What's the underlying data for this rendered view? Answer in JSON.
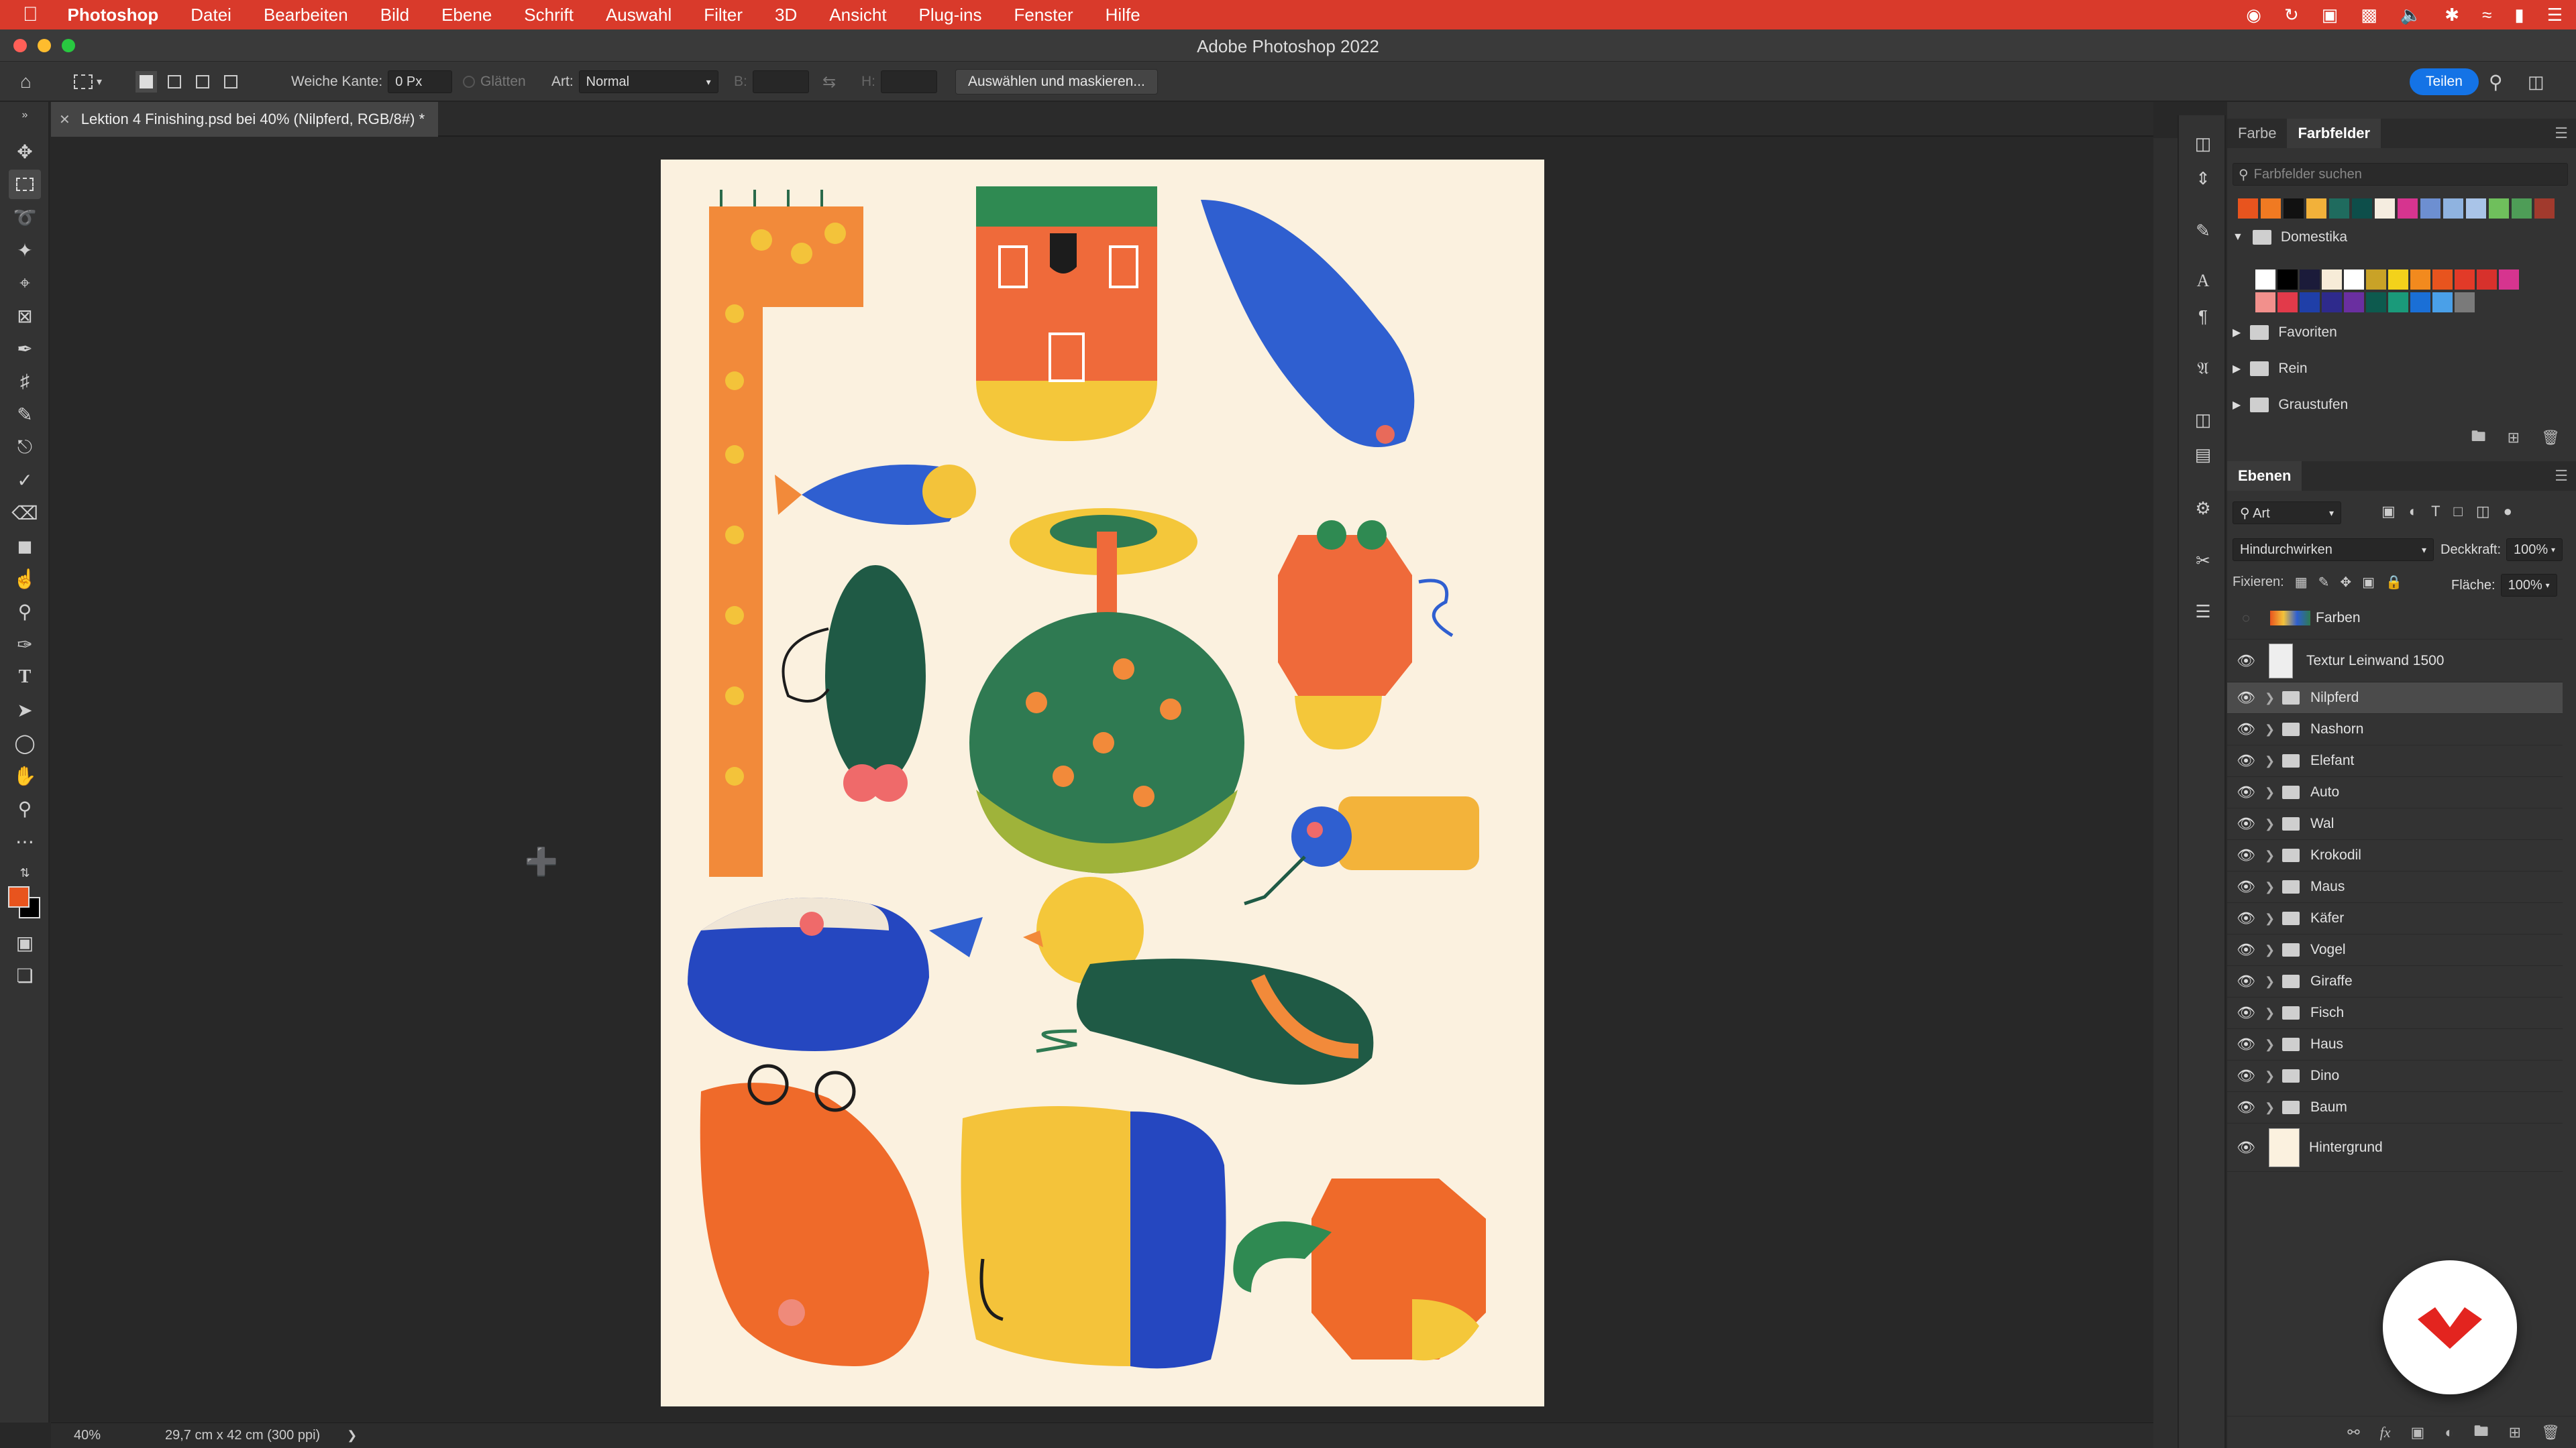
{
  "menubar": {
    "app": "Photoshop",
    "items": [
      "Datei",
      "Bearbeiten",
      "Bild",
      "Ebene",
      "Schrift",
      "Auswahl",
      "Filter",
      "3D",
      "Ansicht",
      "Plug-ins",
      "Fenster",
      "Hilfe"
    ]
  },
  "window": {
    "title": "Adobe Photoshop 2022"
  },
  "options": {
    "feather_label": "Weiche Kante:",
    "feather_value": "0 Px",
    "antialias_label": "Glätten",
    "style_label": "Art:",
    "style_value": "Normal",
    "width_label": "B:",
    "height_label": "H:",
    "select_mask_button": "Auswählen und maskieren...",
    "share_button": "Teilen"
  },
  "document": {
    "tab_title": "Lektion 4 Finishing.psd bei 40% (Nilpferd, RGB/8#) *",
    "zoom": "40%",
    "doc_size": "29,7 cm x 42 cm (300 ppi)"
  },
  "swatches_panel": {
    "tabs": [
      "Farbe",
      "Farbfelder"
    ],
    "active_tab": "Farbfelder",
    "search_placeholder": "Farbfelder suchen",
    "recent_colors": [
      "#e8541e",
      "#f07a22",
      "#111111",
      "#f2b13a",
      "#1f6b5e",
      "#0d4e4a",
      "#f5ede0",
      "#d6348f",
      "#6d8fd1",
      "#8fb3e0",
      "#a9c4e8",
      "#6fbf5c",
      "#4e9d57",
      "#a13a2d"
    ],
    "groups": [
      {
        "name": "Domestika",
        "expanded": true,
        "row1": [
          "#ffffff",
          "#000000",
          "#1b1b3a",
          "#f7ecd8",
          "#ffffff",
          "#c9a227",
          "#f3d21b",
          "#f28a1e",
          "#e8541e",
          "#e23a28",
          "#d7312c",
          "#d6348f"
        ],
        "row2": [
          "#f2908c",
          "#e23a4a",
          "#1f3fa8",
          "#2e2a8c",
          "#6a2fa0",
          "#0d5a4e",
          "#1a9a7a",
          "#1a6fd6",
          "#4aa0e8",
          "#7a7a7a"
        ]
      },
      {
        "name": "Favoriten",
        "expanded": false
      },
      {
        "name": "Rein",
        "expanded": false
      },
      {
        "name": "Graustufen",
        "expanded": false
      }
    ]
  },
  "layers_panel": {
    "title": "Ebenen",
    "filter_value": "Art",
    "blend_mode": "Hindurchwirken",
    "opacity_label": "Deckkraft:",
    "opacity_value": "100%",
    "lock_label": "Fixieren:",
    "fill_label": "Fläche:",
    "fill_value": "100%",
    "layers": [
      {
        "name": "Farben",
        "visible": false,
        "type": "smart"
      },
      {
        "name": "Textur Leinwand 1500",
        "visible": true,
        "type": "pixel"
      },
      {
        "name": "Nilpferd",
        "visible": true,
        "type": "group",
        "selected": true
      },
      {
        "name": "Nashorn",
        "visible": true,
        "type": "group"
      },
      {
        "name": "Elefant",
        "visible": true,
        "type": "group"
      },
      {
        "name": "Auto",
        "visible": true,
        "type": "group"
      },
      {
        "name": "Wal",
        "visible": true,
        "type": "group"
      },
      {
        "name": "Krokodil",
        "visible": true,
        "type": "group"
      },
      {
        "name": "Maus",
        "visible": true,
        "type": "group"
      },
      {
        "name": "Käfer",
        "visible": true,
        "type": "group"
      },
      {
        "name": "Vogel",
        "visible": true,
        "type": "group"
      },
      {
        "name": "Giraffe",
        "visible": true,
        "type": "group"
      },
      {
        "name": "Fisch",
        "visible": true,
        "type": "group"
      },
      {
        "name": "Haus",
        "visible": true,
        "type": "group"
      },
      {
        "name": "Dino",
        "visible": true,
        "type": "group"
      },
      {
        "name": "Baum",
        "visible": true,
        "type": "group"
      },
      {
        "name": "Hintergrund",
        "visible": true,
        "type": "background"
      }
    ]
  },
  "colors": {
    "foreground": "#e8541e",
    "background": "#000000",
    "menubar": "#d93a2b",
    "accent": "#1473e6"
  }
}
